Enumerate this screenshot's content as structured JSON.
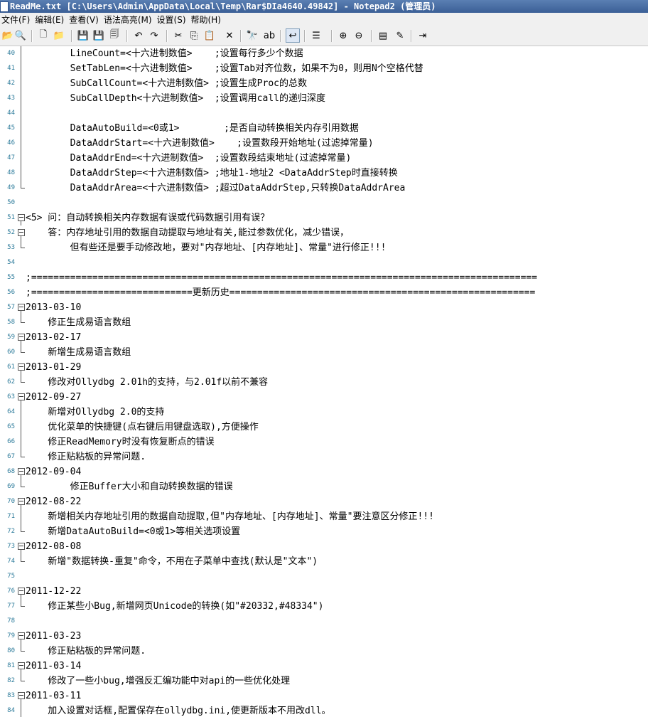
{
  "window": {
    "title": "ReadMe.txt [C:\\Users\\Admin\\AppData\\Local\\Temp\\Rar$DIa4640.49842] - Notepad2 (管理员)"
  },
  "menu": {
    "items": [
      "文件(F)",
      "编辑(E)",
      "查看(V)",
      "语法高亮(M)",
      "设置(S)",
      "帮助(H)"
    ]
  },
  "toolbar": {
    "buttons": [
      {
        "name": "browse-icon",
        "glyph": "📂"
      },
      {
        "name": "find-file-icon",
        "glyph": "🔍"
      },
      {
        "name": "new-file-icon",
        "glyph": "🗋"
      },
      {
        "name": "open-file-icon",
        "glyph": "📁"
      },
      {
        "name": "save-icon",
        "glyph": "💾"
      },
      {
        "name": "save-as-icon",
        "glyph": "💾"
      },
      {
        "name": "save-copy-icon",
        "glyph": "🗐"
      },
      {
        "name": "undo-icon",
        "glyph": "↶"
      },
      {
        "name": "redo-icon",
        "glyph": "↷"
      },
      {
        "name": "cut-icon",
        "glyph": "✂"
      },
      {
        "name": "copy-icon",
        "glyph": "⎘"
      },
      {
        "name": "paste-icon",
        "glyph": "📋"
      },
      {
        "name": "delete-icon",
        "glyph": "✕"
      },
      {
        "name": "find-icon",
        "glyph": "🔭"
      },
      {
        "name": "replace-icon",
        "glyph": "ab"
      },
      {
        "name": "word-wrap-icon",
        "glyph": "↩"
      },
      {
        "name": "list-icon",
        "glyph": "☰"
      },
      {
        "name": "zoom-in-icon",
        "glyph": "⊕"
      },
      {
        "name": "zoom-out-icon",
        "glyph": "⊖"
      },
      {
        "name": "schemes-icon",
        "glyph": "▤"
      },
      {
        "name": "customize-icon",
        "glyph": "✎"
      },
      {
        "name": "exit-icon",
        "glyph": "⇥"
      }
    ]
  },
  "editor": {
    "lines": [
      {
        "n": "40",
        "fold": "line",
        "text": "        LineCount=<十六进制数值>    ;设置每行多少个数据"
      },
      {
        "n": "41",
        "fold": "line",
        "text": "        SetTabLen=<十六进制数值>    ;设置Tab对齐位数，如果不为0，则用N个空格代替"
      },
      {
        "n": "42",
        "fold": "line",
        "text": "        SubCallCount=<十六进制数值> ;设置生成Proc的总数"
      },
      {
        "n": "43",
        "fold": "line",
        "text": "        SubCallDepth<十六进制数值>  ;设置调用call的递归深度"
      },
      {
        "n": "44",
        "fold": "line",
        "text": ""
      },
      {
        "n": "45",
        "fold": "line",
        "text": "        DataAutoBuild=<0或1>        ;是否自动转换相关内存引用数据"
      },
      {
        "n": "46",
        "fold": "line",
        "text": "        DataAddrStart=<十六进制数值>    ;设置数段开始地址(过滤掉常量)"
      },
      {
        "n": "47",
        "fold": "line",
        "text": "        DataAddrEnd=<十六进制数值>  ;设置数段结束地址(过滤掉常量)"
      },
      {
        "n": "48",
        "fold": "line",
        "text": "        DataAddrStep=<十六进制数值> ;地址1-地址2 <DataAddrStep时直接转换"
      },
      {
        "n": "49",
        "fold": "end",
        "text": "        DataAddrArea=<十六进制数值> ;超过DataAddrStep,只转换DataAddrArea"
      },
      {
        "n": "50",
        "fold": "none",
        "text": ""
      },
      {
        "n": "51",
        "fold": "box",
        "text": "<5> 问：自动转换相关内存数据有误或代码数据引用有误？"
      },
      {
        "n": "52",
        "fold": "box",
        "text": "    答：内存地址引用的数据自动提取与地址有关,能过参数优化，减少错误，"
      },
      {
        "n": "53",
        "fold": "end",
        "text": "        但有些还是要手动修改地，要对\"内存地址、[内存地址]、常量\"进行修正!!!"
      },
      {
        "n": "54",
        "fold": "none",
        "text": ""
      },
      {
        "n": "55",
        "fold": "none",
        "text": ";==========================================================================================="
      },
      {
        "n": "56",
        "fold": "none",
        "text": ";=============================更新历史======================================================="
      },
      {
        "n": "57",
        "fold": "box",
        "text": "2013-03-10"
      },
      {
        "n": "58",
        "fold": "end",
        "text": "    修正生成易语言数组"
      },
      {
        "n": "59",
        "fold": "box",
        "text": "2013-02-17"
      },
      {
        "n": "60",
        "fold": "end",
        "text": "    新增生成易语言数组"
      },
      {
        "n": "61",
        "fold": "box",
        "text": "2013-01-29"
      },
      {
        "n": "62",
        "fold": "end",
        "text": "    修改对Ollydbg 2.01h的支持，与2.01f以前不兼容"
      },
      {
        "n": "63",
        "fold": "box",
        "text": "2012-09-27"
      },
      {
        "n": "64",
        "fold": "line",
        "text": "    新增对Ollydbg 2.0的支持"
      },
      {
        "n": "65",
        "fold": "line",
        "text": "    优化菜单的快捷键(点右键后用键盘选取),方便操作"
      },
      {
        "n": "66",
        "fold": "line",
        "text": "    修正ReadMemory时没有恢复断点的错误"
      },
      {
        "n": "67",
        "fold": "end",
        "text": "    修正贴粘板的异常问题."
      },
      {
        "n": "68",
        "fold": "box",
        "text": "2012-09-04"
      },
      {
        "n": "69",
        "fold": "end",
        "text": "        修正Buffer大小和自动转换数据的错误"
      },
      {
        "n": "70",
        "fold": "box",
        "text": "2012-08-22"
      },
      {
        "n": "71",
        "fold": "line",
        "text": "    新增相关内存地址引用的数据自动提取,但\"内存地址、[内存地址]、常量\"要注意区分修正!!!"
      },
      {
        "n": "72",
        "fold": "end",
        "text": "    新增DataAutoBuild=<0或1>等相关选项设置"
      },
      {
        "n": "73",
        "fold": "box",
        "text": "2012-08-08"
      },
      {
        "n": "74",
        "fold": "end",
        "text": "    新增\"数据转换-重复\"命令，不用在子菜单中查找(默认是\"文本\")"
      },
      {
        "n": "75",
        "fold": "none",
        "text": ""
      },
      {
        "n": "76",
        "fold": "box",
        "text": "2011-12-22"
      },
      {
        "n": "77",
        "fold": "end",
        "text": "    修正某些小Bug,新增网页Unicode的转换(如\"#20332,#48334\")"
      },
      {
        "n": "78",
        "fold": "none",
        "text": ""
      },
      {
        "n": "79",
        "fold": "box",
        "text": "2011-03-23"
      },
      {
        "n": "80",
        "fold": "end",
        "text": "    修正贴粘板的异常问题."
      },
      {
        "n": "81",
        "fold": "box",
        "text": "2011-03-14"
      },
      {
        "n": "82",
        "fold": "end",
        "text": "    修改了一些小bug,增强反汇编功能中对api的一些优化处理"
      },
      {
        "n": "83",
        "fold": "box",
        "text": "2011-03-11"
      },
      {
        "n": "84",
        "fold": "line",
        "text": "    加入设置对话框,配置保存在ollydbg.ini,使更新版本不用改dll。"
      }
    ]
  }
}
